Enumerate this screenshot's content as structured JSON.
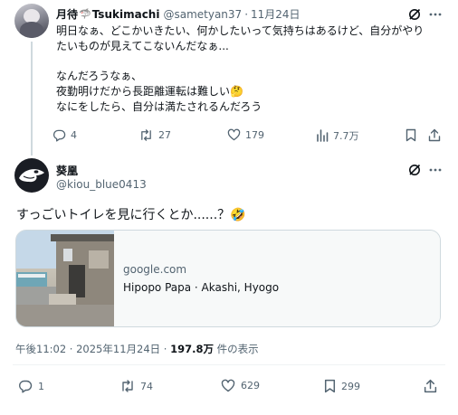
{
  "parent_tweet": {
    "display_name": "月待",
    "display_name_suffix": "Tsukimachi",
    "handle": "@sametyan37",
    "separator": "·",
    "date": "11月24日",
    "lines": [
      "明日なぁ、どこかいきたい、何かしたいって気持ちはあるけど、自分がやり",
      "たいものが見えてこないんだなぁ...",
      "",
      "なんだろうなぁ、",
      "夜勤明けだから長距離運転は難しい🤔",
      "なにをしたら、自分は満たされるんだろう"
    ],
    "stats": {
      "replies": "4",
      "retweets": "27",
      "likes": "179",
      "views": "7.7万"
    }
  },
  "reply_tweet": {
    "display_name": "葵凰",
    "handle": "@kiou_blue0413",
    "text": "すっごいトイレを見に行くとか......？🤣",
    "link_card": {
      "domain": "google.com",
      "title": "Hipopo Papa · Akashi, Hyogo"
    },
    "timestamp": "午後11:02 · 2025年11月24日 · ",
    "views_count": "197.8万",
    "views_suffix": " 件の表示",
    "stats": {
      "replies": "1",
      "retweets": "74",
      "likes": "629",
      "bookmarks": "299"
    }
  },
  "icons": [
    "grok-icon",
    "more-icon",
    "reply-icon",
    "retweet-icon",
    "like-icon",
    "views-icon",
    "bookmark-icon",
    "share-icon"
  ],
  "colors": {
    "text": "#0f1419",
    "muted": "#536471",
    "border": "#cfd9de",
    "link_bg": "#f7f9f9"
  }
}
